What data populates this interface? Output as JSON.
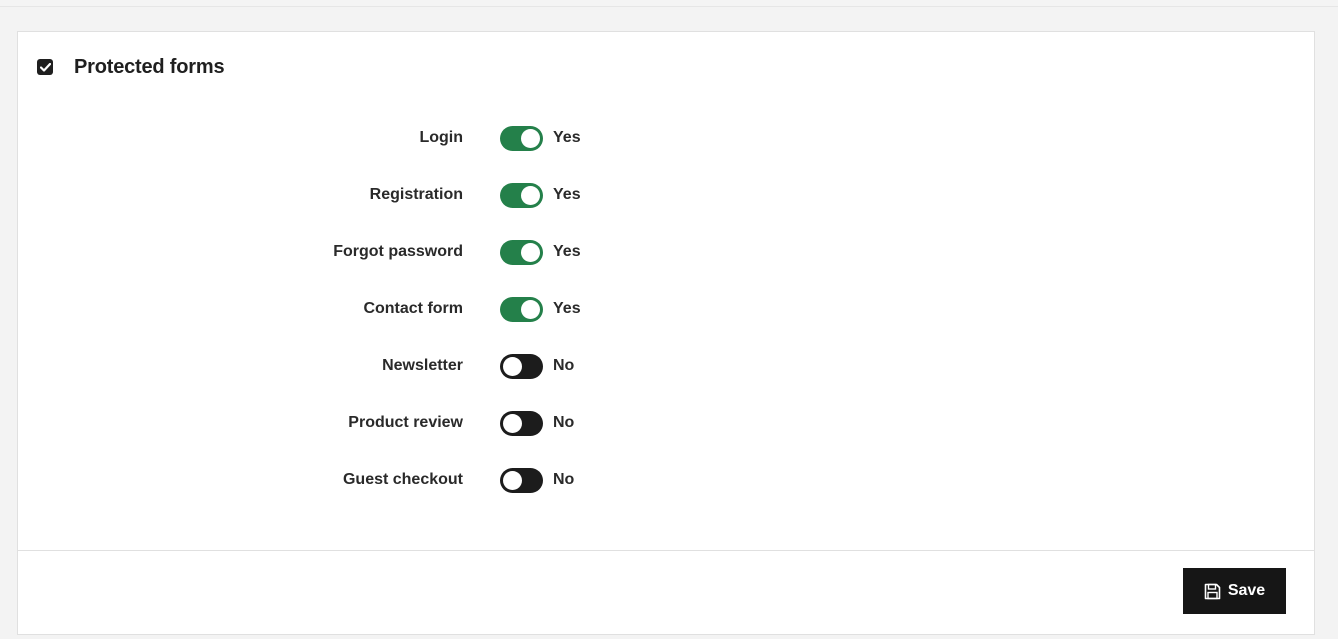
{
  "section": {
    "title": "Protected forms",
    "checked": true
  },
  "forms": [
    {
      "label": "Login",
      "enabled": true,
      "state_text": "Yes"
    },
    {
      "label": "Registration",
      "enabled": true,
      "state_text": "Yes"
    },
    {
      "label": "Forgot password",
      "enabled": true,
      "state_text": "Yes"
    },
    {
      "label": "Contact form",
      "enabled": true,
      "state_text": "Yes"
    },
    {
      "label": "Newsletter",
      "enabled": false,
      "state_text": "No"
    },
    {
      "label": "Product review",
      "enabled": false,
      "state_text": "No"
    },
    {
      "label": "Guest checkout",
      "enabled": false,
      "state_text": "No"
    }
  ],
  "footer": {
    "save_label": "Save",
    "save_icon": "floppy-disk-icon"
  },
  "colors": {
    "toggle_on": "#24804a",
    "toggle_off": "#1c1c1c",
    "button_bg": "#161616"
  }
}
